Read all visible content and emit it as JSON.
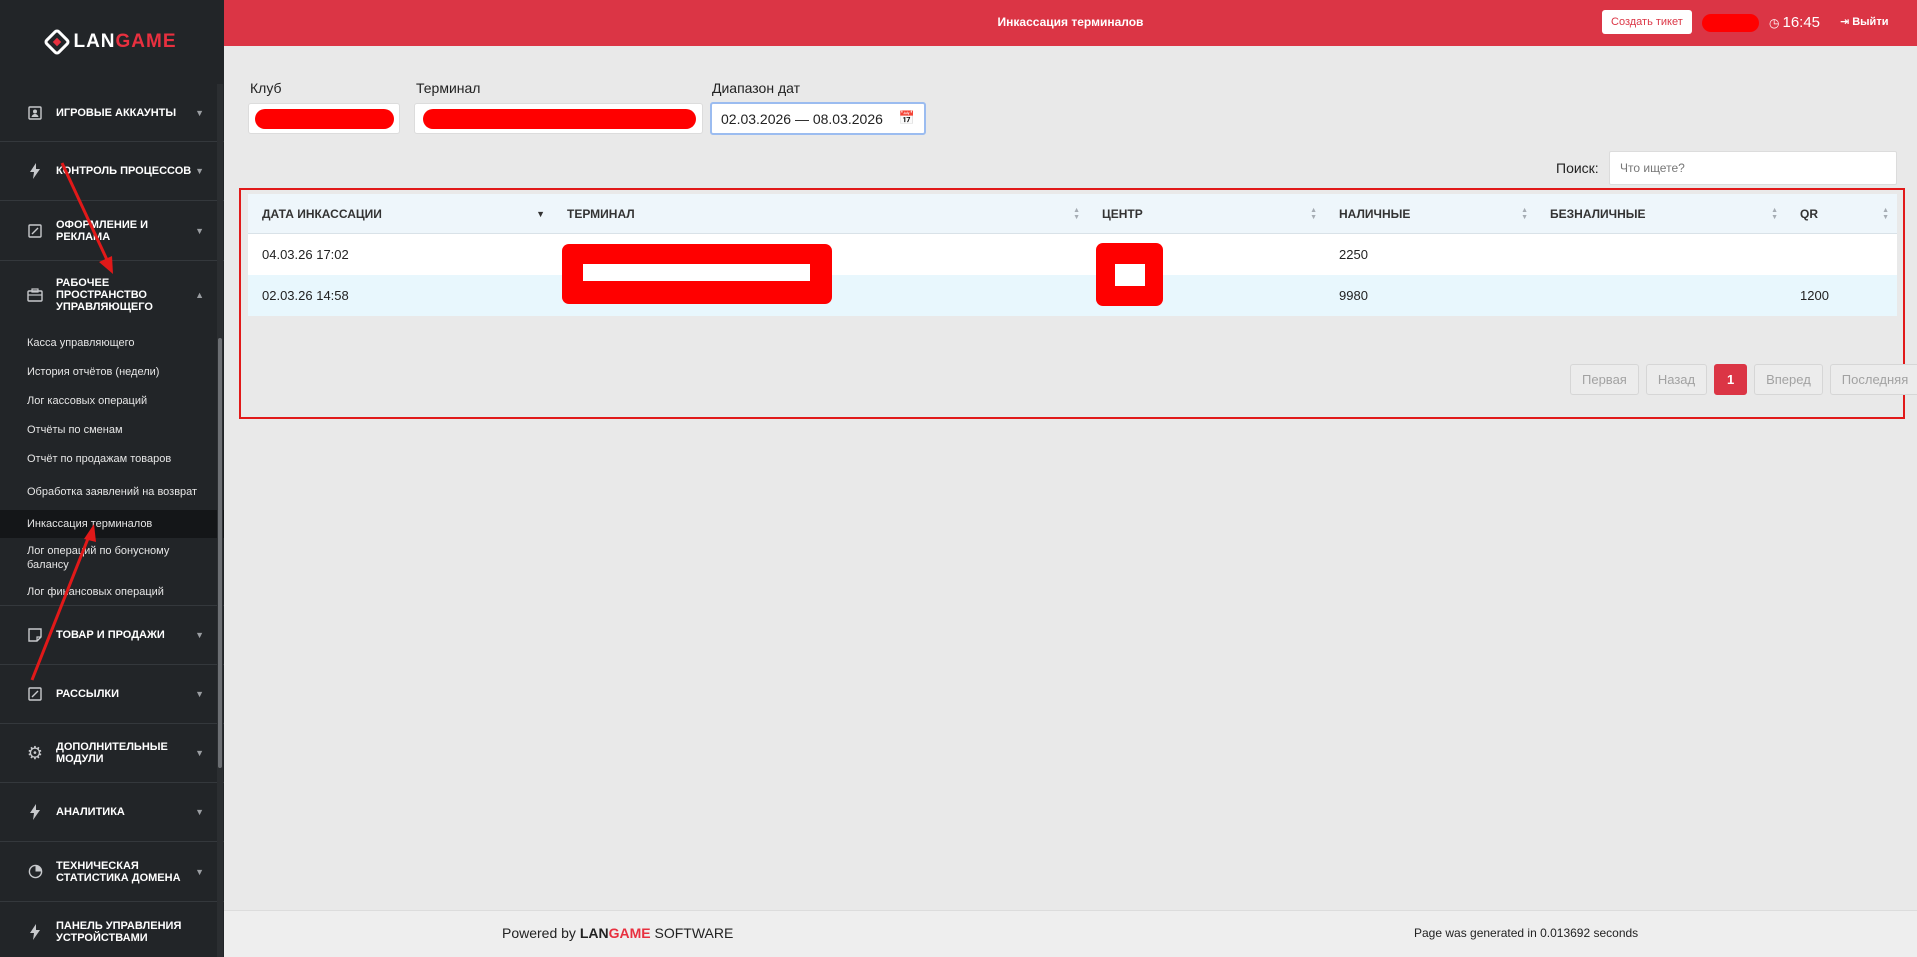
{
  "sidebar": {
    "logo_a": "LAN",
    "logo_b": "GAME",
    "groups": [
      {
        "label": "ИГРОВЫЕ АККАУНТЫ",
        "icon": "user-badge-icon"
      },
      {
        "label": "КОНТРОЛЬ ПРОЦЕССОВ",
        "icon": "lightning-icon"
      },
      {
        "label": "ОФОРМЛЕНИЕ И РЕКЛАМА",
        "icon": "edit-square-icon"
      },
      {
        "label": "РАБОЧЕЕ ПРОСТРАНСТВО УПРАВЛЯЮЩЕГО",
        "icon": "briefcase-icon"
      },
      {
        "label": "ТОВАР И ПРОДАЖИ",
        "icon": "sticky-note-icon"
      },
      {
        "label": "РАССЫЛКИ",
        "icon": "edit-square-icon"
      },
      {
        "label": "ДОПОЛНИТЕЛЬНЫЕ МОДУЛИ",
        "icon": "gear-icon"
      },
      {
        "label": "АНАЛИТИКА",
        "icon": "lightning-icon"
      },
      {
        "label": "ТЕХНИЧЕСКАЯ СТАТИСТИКА ДОМЕНА",
        "icon": "pie-chart-icon"
      },
      {
        "label": "ПАНЕЛЬ УПРАВЛЕНИЯ УСТРОЙСТВАМИ",
        "icon": "lightning-icon"
      }
    ],
    "sub_items": [
      "Касса управляющего",
      "История отчётов (недели)",
      "Лог кассовых операций",
      "Отчёты по сменам",
      "Отчёт по продажам товаров",
      "Обработка заявлений на возврат",
      "Инкассация терминалов",
      "Лог операций по бонусному балансу",
      "Лог финансовых операций"
    ],
    "active_sub": "Инкассация терминалов"
  },
  "topbar": {
    "title": "Инкассация терминалов",
    "ticket_label": "Создать тикет",
    "time": "16:45",
    "logout_label": "Выйти"
  },
  "filters": {
    "club_label": "Клуб",
    "terminal_label": "Терминал",
    "date_label": "Диапазон дат",
    "date_value": "02.03.2026 — 08.03.2026"
  },
  "search": {
    "label": "Поиск:",
    "placeholder": "Что ищете?"
  },
  "table": {
    "columns": [
      "Дата инкассации",
      "Терминал",
      "Центр",
      "Наличные",
      "Безналичные",
      "QR"
    ],
    "rows": [
      {
        "date": "04.03.26 17:02",
        "cash": "2250",
        "cashless": "",
        "qr": ""
      },
      {
        "date": "02.03.26 14:58",
        "cash": "9980",
        "cashless": "",
        "qr": "1200"
      }
    ]
  },
  "pagination": {
    "first": "Первая",
    "prev": "Назад",
    "current": "1",
    "next": "Вперед",
    "last": "Последняя"
  },
  "footer": {
    "powered_by": "Powered by",
    "brand_a": "LAN",
    "brand_b": "GAME",
    "software": "SOFTWARE",
    "generated": "Page was generated in 0.013692 seconds"
  },
  "colors": {
    "accent": "#db3545",
    "sidebar_bg": "#222528",
    "redaction": "#ff0000"
  }
}
